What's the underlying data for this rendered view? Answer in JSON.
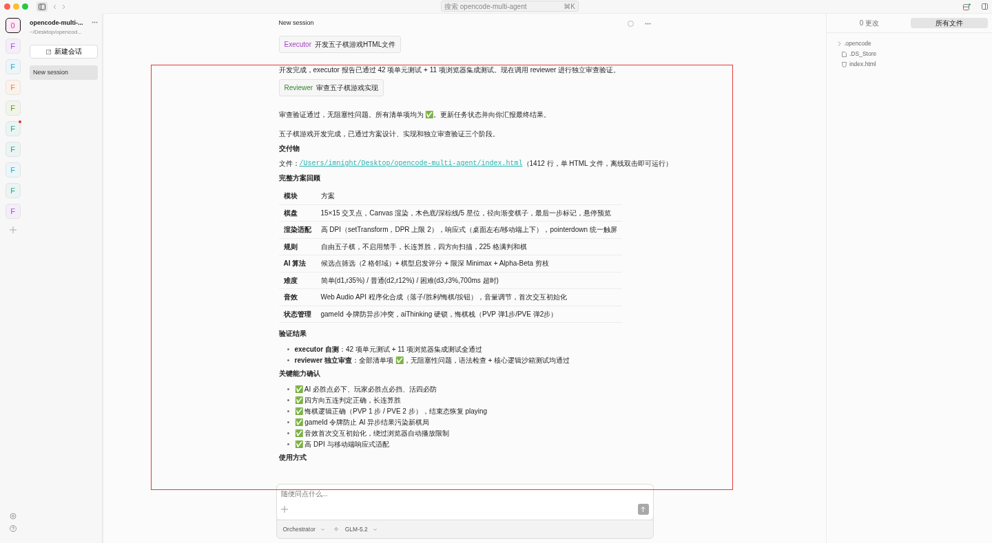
{
  "window": {
    "search": "搜索 opencode-multi-agent",
    "shortcut": "⌘K"
  },
  "projects": [
    {
      "letter": "0",
      "color": "#d6399b",
      "selected": true,
      "unread": false
    },
    {
      "letter": "F",
      "color": "#9b4fd1",
      "selected": false,
      "unread": false
    },
    {
      "letter": "F",
      "color": "#2aa6c9",
      "selected": false,
      "unread": false
    },
    {
      "letter": "F",
      "color": "#ef7a2f",
      "selected": false,
      "unread": false
    },
    {
      "letter": "F",
      "color": "#6e8f1e",
      "selected": false,
      "unread": false
    },
    {
      "letter": "F",
      "color": "#2a9d84",
      "selected": false,
      "unread": true
    },
    {
      "letter": "F",
      "color": "#2a9d84",
      "selected": false,
      "unread": false
    },
    {
      "letter": "F",
      "color": "#2aa6c9",
      "selected": false,
      "unread": false
    },
    {
      "letter": "F",
      "color": "#2a9d84",
      "selected": false,
      "unread": false
    },
    {
      "letter": "F",
      "color": "#9b4fd1",
      "selected": false,
      "unread": false
    }
  ],
  "sidebar": {
    "project_name": "opencode-multi-...",
    "project_path": "~/Desktop/opencod...",
    "new_session": "新建会话",
    "sessions": [
      {
        "title": "New session",
        "selected": true
      }
    ]
  },
  "session": {
    "title": "New session"
  },
  "messages": [
    {
      "kind": "task",
      "agent": "Executor",
      "color": "#a63bc4",
      "title": "开发五子棋游戏HTML文件"
    },
    {
      "kind": "paragraph",
      "text": "开发完成，executor 报告已通过 42 项单元测试 + 11 项浏览器集成测试。现在调用 reviewer 进行独立审查验证。"
    },
    {
      "kind": "task",
      "agent": "Reviewer",
      "color": "#2f8a2f",
      "title": "审查五子棋游戏实现"
    },
    {
      "kind": "paragraph",
      "text": "审查验证通过，无阻塞性问题。所有清单项均为 ✅。更新任务状态并向你汇报最终结果。"
    },
    {
      "kind": "paragraph",
      "text": "五子棋游戏开发完成，已通过方案设计、实现和独立审查验证三个阶段。"
    },
    {
      "kind": "heading",
      "text": "交付物"
    },
    {
      "kind": "file",
      "label": "文件：",
      "path": "/Users/imnight/Desktop/opencode-multi-agent/index.html",
      "note": "（1412 行，单 HTML 文件，离线双击即可运行）"
    },
    {
      "kind": "heading",
      "text": "完整方案回顾"
    },
    {
      "kind": "table",
      "columns": [
        "模块",
        "方案"
      ],
      "rows": [
        [
          "棋盘",
          "15×15 交叉点，Canvas 渲染，木色底/深棕线/5 星位，径向渐变棋子，最后一步标记，悬停预览"
        ],
        [
          "渲染适配",
          "高 DPI（setTransform，DPR 上限 2），响应式（桌面左右/移动端上下），pointerdown 统一触屏"
        ],
        [
          "规则",
          "自由五子棋，不启用禁手，长连算胜，四方向扫描，225 格满判和棋"
        ],
        [
          "AI 算法",
          "候选点筛选（2 格邻域）+ 棋型启发评分 + 限深 Minimax + Alpha-Beta 剪枝"
        ],
        [
          "难度",
          "简单(d1,r35%) / 普通(d2,r12%) / 困难(d3,r3%,700ms 超时)"
        ],
        [
          "音效",
          "Web Audio API 程序化合成（落子/胜利/悔棋/按钮），音量调节，首次交互初始化"
        ],
        [
          "状态管理",
          "gameId 令牌防异步冲突，aiThinking 硬锁，悔棋栈（PVP 弹1步/PVE 弹2步）"
        ]
      ]
    },
    {
      "kind": "heading",
      "text": "验证结果"
    },
    {
      "kind": "bullets",
      "items": [
        {
          "lead": "executor 自测",
          "text": "：42 项单元测试 + 11 项浏览器集成测试全通过"
        },
        {
          "lead": "reviewer 独立审查",
          "text": "：全部清单项 ✅，无阻塞性问题，语法检查 + 核心逻辑沙箱测试均通过"
        }
      ]
    },
    {
      "kind": "heading",
      "text": "关键能力确认"
    },
    {
      "kind": "bullets",
      "items": [
        {
          "text": "✅ AI 必胜点必下、玩家必胜点必挡、活四必防"
        },
        {
          "text": "✅ 四方向五连判定正确，长连算胜"
        },
        {
          "text": "✅ 悔棋逻辑正确（PVP 1 步 / PVE 2 步），结束态恢复 playing"
        },
        {
          "text": "✅ gameId 令牌防止 AI 异步结果污染新棋局"
        },
        {
          "text": "✅ 音效首次交互初始化，绕过浏览器自动播放限制"
        },
        {
          "text": "✅ 高 DPI 与移动端响应式适配"
        }
      ]
    },
    {
      "kind": "heading",
      "text": "使用方式"
    }
  ],
  "composer": {
    "placeholder": "随便问点什么...",
    "agent": "Orchestrator",
    "model": "GLM-5.2"
  },
  "files_panel": {
    "tabs": [
      {
        "label": "0 更改",
        "selected": false
      },
      {
        "label": "所有文件",
        "selected": true
      }
    ],
    "tree": [
      {
        "kind": "folder",
        "name": ".opencode",
        "expanded": false
      },
      {
        "kind": "file",
        "name": ".DS_Store"
      },
      {
        "kind": "html",
        "name": "index.html"
      }
    ]
  },
  "highlight_frame": true
}
